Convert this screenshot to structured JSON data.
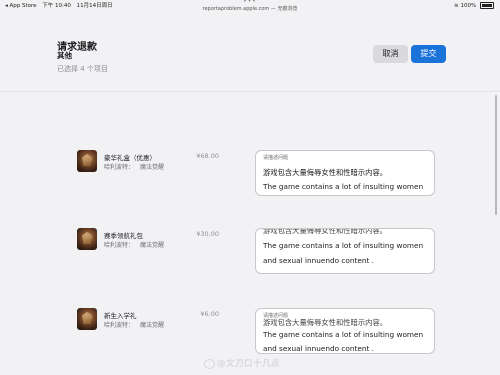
{
  "status_bar": {
    "carrier": "◂ App Store",
    "time": "下午 10:40",
    "date": "11月14日周日",
    "url": "reportaproblem.apple.com — 无痕浏览",
    "battery": "100%"
  },
  "header": {
    "title": "请求退款",
    "subtitle": "其他",
    "selected_count": "已选择 4 个项目",
    "cancel_label": "取消",
    "submit_label": "提交"
  },
  "items": [
    {
      "name": "豪华礼盒（优惠）",
      "developer": "哈利波特：",
      "game": "魔法觉醒",
      "price": "¥68.00",
      "reason_label": "请描述问题",
      "reason_lines": [
        "游戏包含大量侮辱女性和性暗示内容。",
        "The game contains a lot of insulting women"
      ]
    },
    {
      "name": "赛季领航礼包",
      "developer": "哈利波特：",
      "game": "魔法觉醒",
      "price": "¥30.00",
      "reason_label": "",
      "reason_lines": [
        "游戏包含大量侮辱女性和性暗示内容。",
        "The game contains a lot of insulting women",
        "and sexual innuendo content ."
      ]
    },
    {
      "name": "新生入学礼",
      "developer": "哈利波特：",
      "game": "魔法觉醒",
      "price": "¥6.00",
      "reason_label": "请描述问题",
      "reason_lines": [
        "游戏包含大量侮辱女性和性暗示内容。",
        "The game contains a lot of insulting women",
        "and sexual innuendo content ."
      ]
    }
  ],
  "watermark": "@文刀口十几点",
  "colors": {
    "accent": "#1a73d9",
    "background": "#f2f2f4"
  }
}
